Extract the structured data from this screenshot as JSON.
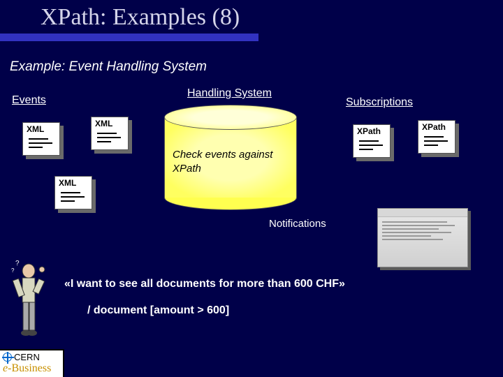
{
  "title": "XPath: Examples (8)",
  "subtitle": "Example: Event Handling System",
  "labels": {
    "events": "Events",
    "handling": "Handling System",
    "subscriptions": "Subscriptions",
    "notifications": "Notifications"
  },
  "doc_labels": {
    "xml": "XML",
    "xpath": "XPath"
  },
  "cylinder_text": "Check events against XPath",
  "quote": "«I want to see all documents for more than 600 CHF»",
  "xpath_expr": "/ document [amount > 600]",
  "footer": {
    "org": "CERN",
    "tagline_e": "e",
    "tagline_rest": "-Business"
  }
}
